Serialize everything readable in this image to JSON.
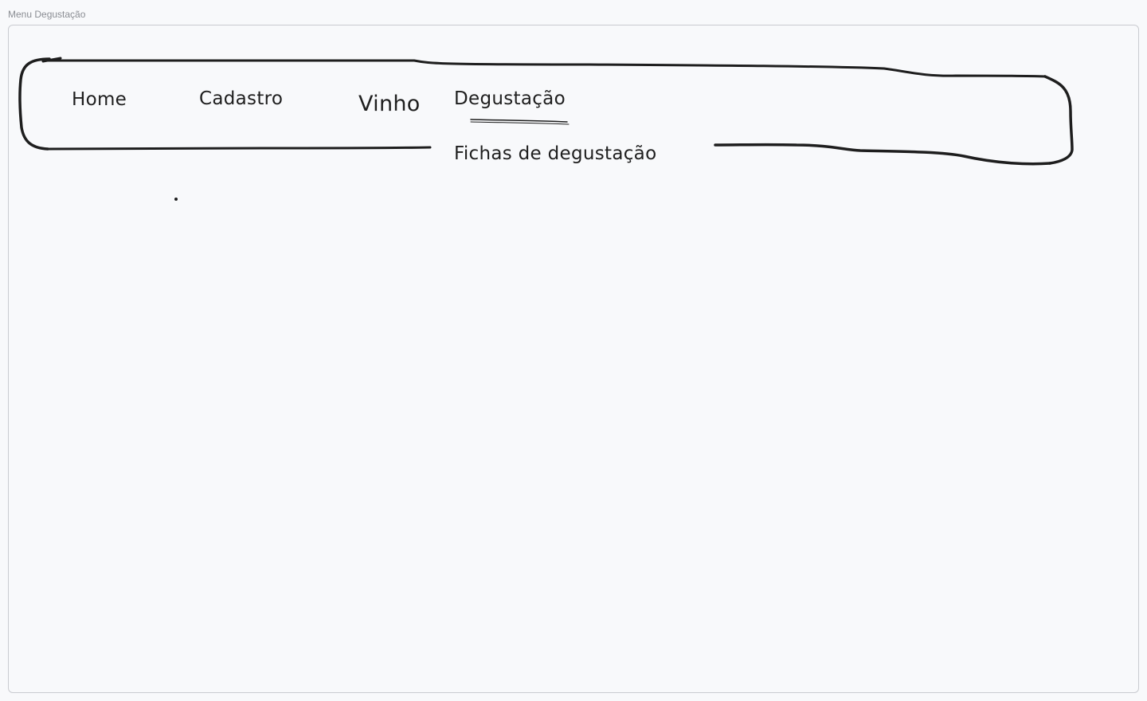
{
  "frame": {
    "title": "Menu Degustação"
  },
  "nav": {
    "items": [
      {
        "label": "Home"
      },
      {
        "label": "Cadastro"
      },
      {
        "label": "Vinho"
      },
      {
        "label": "Degustação",
        "active": true
      }
    ]
  },
  "submenu": {
    "items": [
      {
        "label": "Fichas de degustação"
      }
    ]
  },
  "colors": {
    "ink": "#1e1e1e",
    "canvas": "#f8f9fb",
    "frame_border": "#c9cbd0",
    "frame_title": "#8a8d93"
  }
}
